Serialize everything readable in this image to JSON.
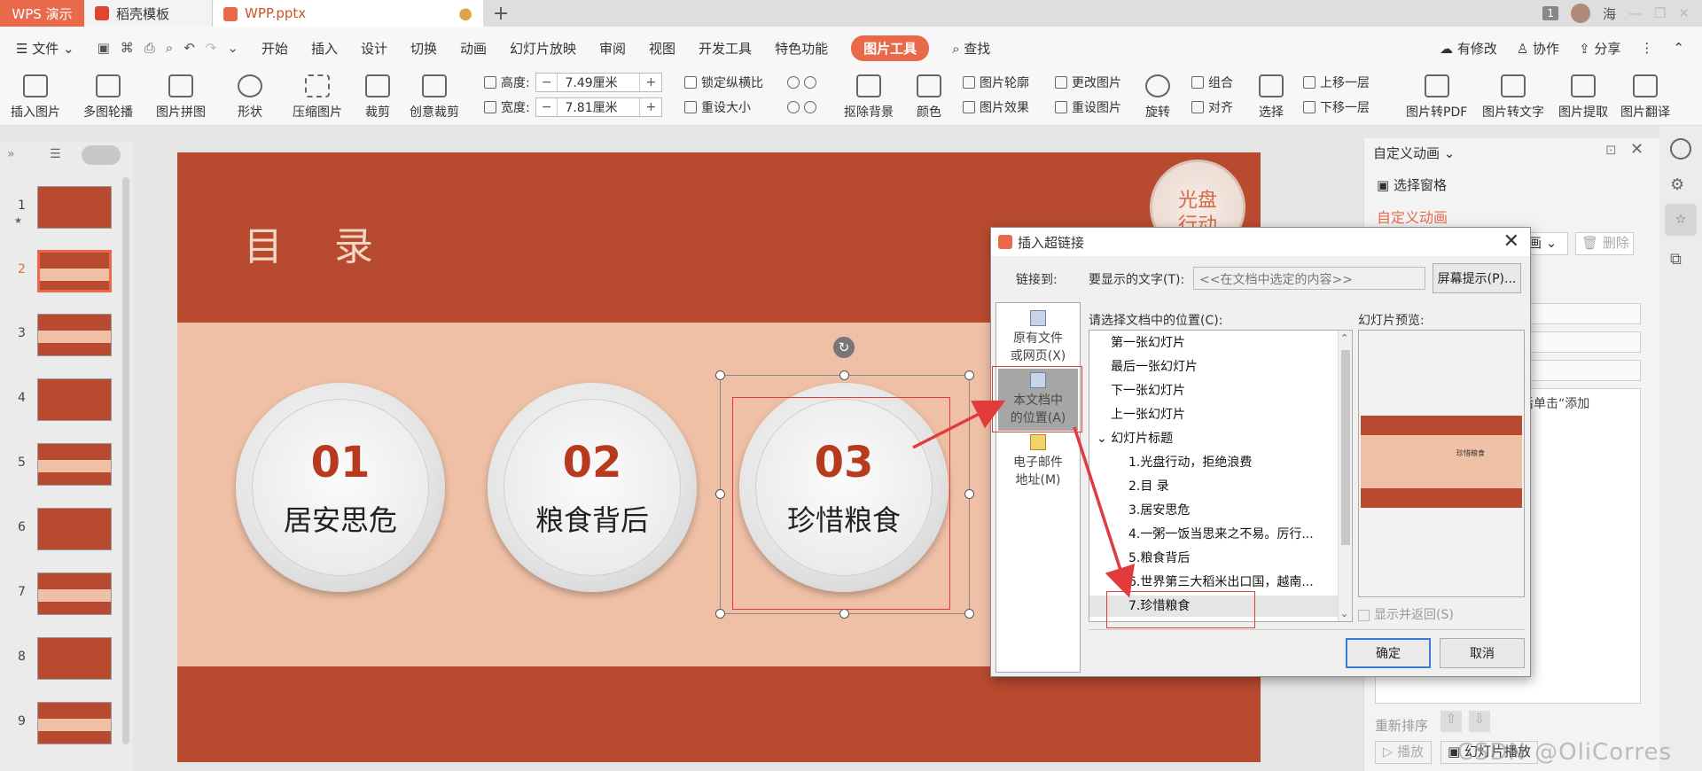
{
  "titlebar": {
    "tabs": [
      {
        "label": "WPS 演示"
      },
      {
        "label": "稻壳模板"
      },
      {
        "label": "WPP.pptx"
      }
    ],
    "badge_num": "1",
    "user": "海"
  },
  "menu": {
    "file": "文件",
    "items": [
      "开始",
      "插入",
      "设计",
      "切换",
      "动画",
      "幻灯片放映",
      "审阅",
      "视图",
      "开发工具",
      "特色功能",
      "图片工具"
    ],
    "search": "查找",
    "right": [
      "有修改",
      "协作",
      "分享"
    ]
  },
  "ribbon": {
    "insert_pic": "插入图片",
    "multi_carousel": "多图轮播",
    "pic_collage": "图片拼图",
    "shape": "形状",
    "compress": "压缩图片",
    "crop": "裁剪",
    "creative_crop": "创意裁剪",
    "height_label": "高度:",
    "height_val": "7.49厘米",
    "width_label": "宽度:",
    "width_val": "7.81厘米",
    "lock_ratio": "锁定纵横比",
    "reset_size": "重设大小",
    "remove_bg": "抠除背景",
    "color": "颜色",
    "pic_outline": "图片轮廓",
    "pic_effect": "图片效果",
    "change_pic": "更改图片",
    "reset_pic": "重设图片",
    "rotate": "旋转",
    "group": "组合",
    "align": "对齐",
    "select": "选择",
    "bring_forward": "上移一层",
    "send_backward": "下移一层",
    "to_pdf": "图片转PDF",
    "to_text": "图片转文字",
    "extract": "图片提取",
    "translate": "图片翻译"
  },
  "thumbs": {
    "numbers": [
      "1",
      "2",
      "3",
      "4",
      "5",
      "6",
      "7",
      "8",
      "9"
    ]
  },
  "slide": {
    "title": "目 录",
    "badge": "光盘\n行动",
    "plates": [
      {
        "num": "01",
        "label": "居安思危"
      },
      {
        "num": "02",
        "label": "粮食背后"
      },
      {
        "num": "03",
        "label": "珍惜粮食"
      }
    ]
  },
  "rpanel": {
    "title": "自定义动画",
    "select_pane": "选择窗格",
    "custom_anim": "自定义动画",
    "delete": "删除",
    "anim_sel": "画",
    "hint": "然后单击“添加",
    "reorder": "重新排序",
    "play": "播放",
    "slideshow": "幻灯片播放"
  },
  "dialog": {
    "title": "插入超链接",
    "link_to": "链接到:",
    "display_text_label": "要显示的文字(T):",
    "display_text_value": "<<在文档中选定的内容>>",
    "screen_tip": "屏幕提示(P)...",
    "link_items": [
      {
        "label": "原有文件\n或网页(X)"
      },
      {
        "label": "本文档中\n的位置(A)"
      },
      {
        "label": "电子邮件\n地址(M)"
      }
    ],
    "location_label": "请选择文档中的位置(C):",
    "tree": [
      "第一张幻灯片",
      "最后一张幻灯片",
      "下一张幻灯片",
      "上一张幻灯片",
      "幻灯片标题",
      "1.光盘行动，拒绝浪费",
      "2.目 录",
      "3.居安思危",
      "4.一粥一饭当思来之不易。厉行...",
      "5.粮食背后",
      "6.世界第三大稻米出口国，越南...",
      "7.珍惜粮食"
    ],
    "preview_label": "幻灯片预览:",
    "preview_text": "珍惜粮食",
    "show_return": "显示并返回(S)",
    "ok": "确定",
    "cancel": "取消"
  },
  "watermark": "CSDN @OliCorres",
  "colors": {
    "accent": "#e96a4a",
    "slide_red": "#b84a30",
    "slide_band": "#efc0a6",
    "annotation_red": "#e23b3b"
  }
}
